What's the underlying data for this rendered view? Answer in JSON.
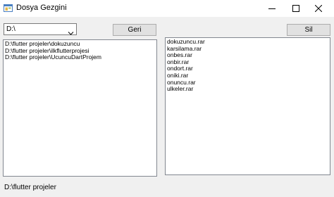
{
  "window": {
    "title": "Dosya Gezgini",
    "icon": "app-form-icon"
  },
  "toolbar": {
    "drive_select_value": "D:\\",
    "back_button_label": "Geri",
    "delete_button_label": "Sil"
  },
  "left_list": {
    "items": [
      "D:\\flutter projeler\\dokuzuncu",
      "D:\\flutter projeler\\ilkflutterprojesi",
      "D:\\flutter projeler\\UcuncuDartProjem"
    ]
  },
  "right_list": {
    "items": [
      "dokuzuncu.rar",
      "karsilama.rar",
      "onbes.rar",
      "onbir.rar",
      "ondort.rar",
      "oniki.rar",
      "onuncu.rar",
      "ulkeler.rar"
    ]
  },
  "status": {
    "current_path": "D:\\flutter projeler"
  }
}
